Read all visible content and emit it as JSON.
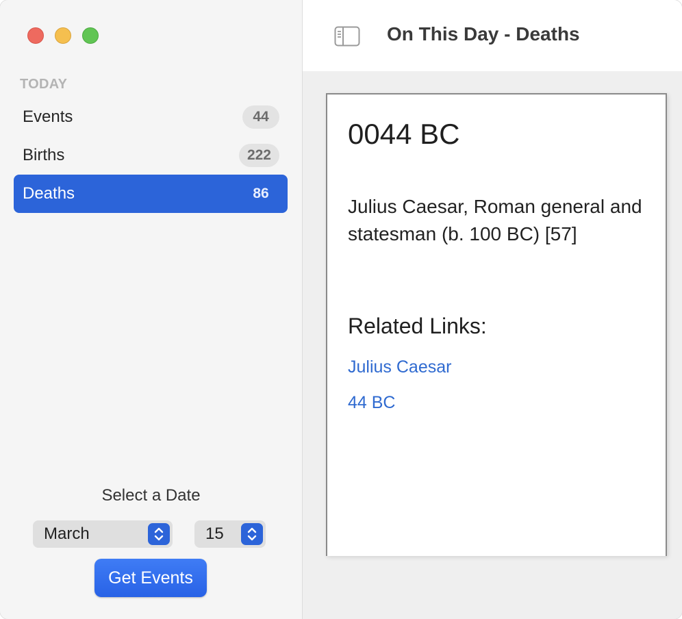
{
  "sidebar": {
    "section_label": "TODAY",
    "items": [
      {
        "label": "Events",
        "count": "44"
      },
      {
        "label": "Births",
        "count": "222"
      },
      {
        "label": "Deaths",
        "count": "86"
      }
    ],
    "active_item": "Deaths",
    "date_label": "Select a Date",
    "month_value": "March",
    "day_value": "15",
    "get_button": "Get Events"
  },
  "toolbar": {
    "title": "On This Day - Deaths",
    "toggle_icon": "sidebar-toggle-icon"
  },
  "detail": {
    "year": "0044 BC",
    "description": "Julius Caesar, Roman general and statesman (b. 100 BC) [57]",
    "related_heading": "Related Links:",
    "links": [
      "Julius Caesar",
      "44 BC"
    ]
  },
  "colors": {
    "accent": "#2c64d9",
    "link": "#2f6ad0",
    "traffic_red": "#ee6a5f",
    "traffic_yellow": "#f5bf4f",
    "traffic_green": "#61c554"
  }
}
